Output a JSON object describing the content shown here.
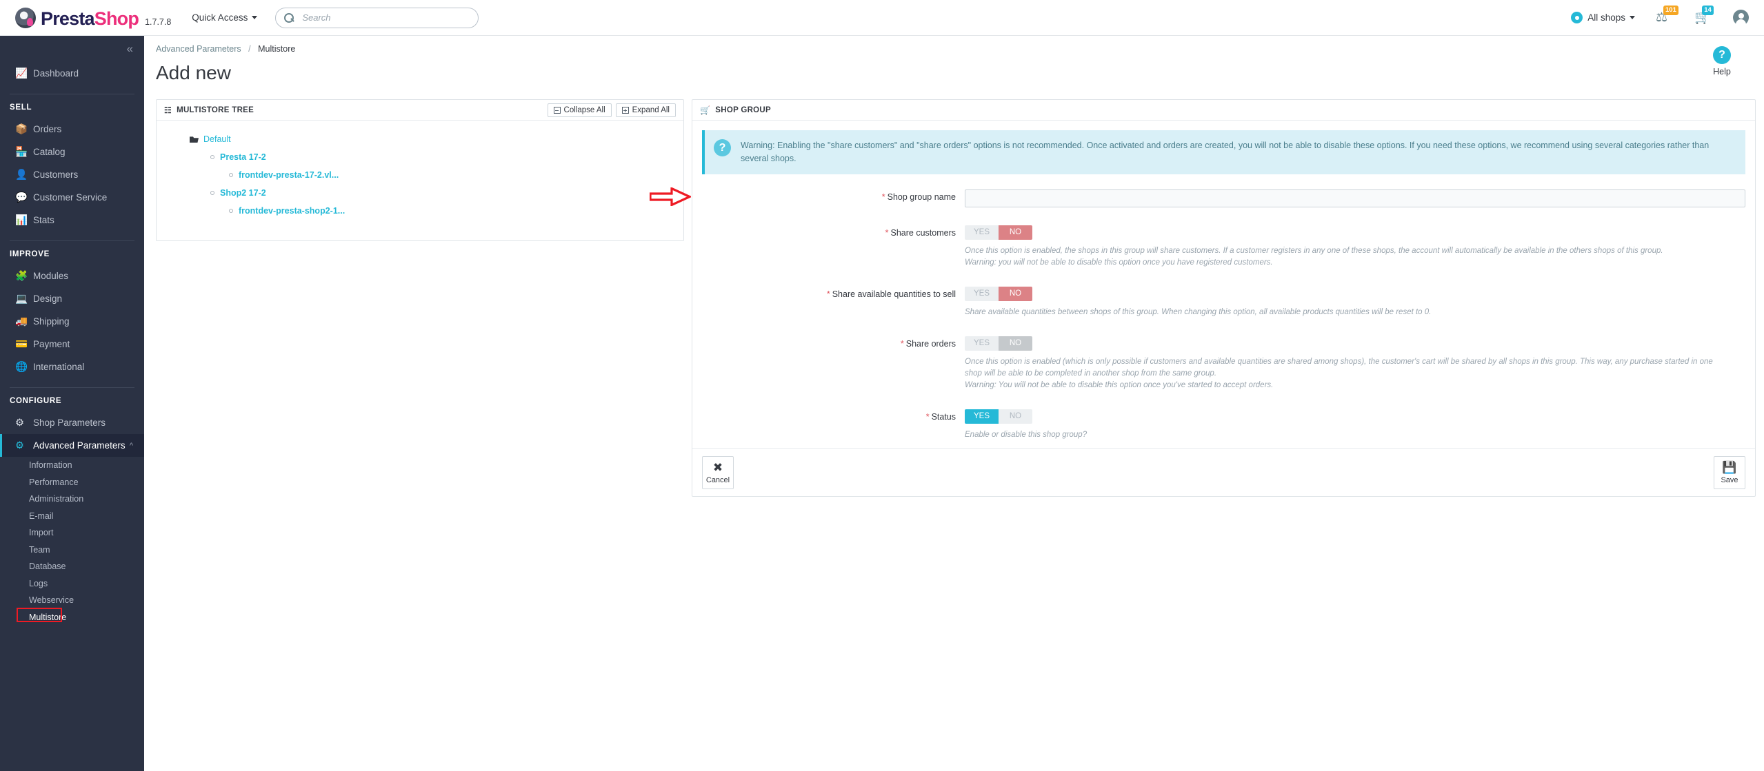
{
  "header": {
    "logo_name_part1": "Presta",
    "logo_name_part2": "Shop",
    "version": "1.7.7.8",
    "quick_access_label": "Quick Access",
    "search_placeholder": "Search",
    "search_value": "",
    "all_shops_label": "All shops",
    "badge_orders_count": "101",
    "badge_cart_count": "14"
  },
  "sidebar": {
    "collapse_label": "«",
    "dashboard_label": "Dashboard",
    "group_sell": "SELL",
    "sell_items": [
      {
        "label": "Orders"
      },
      {
        "label": "Catalog"
      },
      {
        "label": "Customers"
      },
      {
        "label": "Customer Service"
      },
      {
        "label": "Stats"
      }
    ],
    "group_improve": "IMPROVE",
    "improve_items": [
      {
        "label": "Modules"
      },
      {
        "label": "Design"
      },
      {
        "label": "Shipping"
      },
      {
        "label": "Payment"
      },
      {
        "label": "International"
      }
    ],
    "group_configure": "CONFIGURE",
    "configure_items": [
      {
        "label": "Shop Parameters"
      },
      {
        "label": "Advanced Parameters"
      }
    ],
    "advanced_sub_items": [
      {
        "label": "Information"
      },
      {
        "label": "Performance"
      },
      {
        "label": "Administration"
      },
      {
        "label": "E-mail"
      },
      {
        "label": "Import"
      },
      {
        "label": "Team"
      },
      {
        "label": "Database"
      },
      {
        "label": "Logs"
      },
      {
        "label": "Webservice"
      },
      {
        "label": "Multistore"
      }
    ]
  },
  "breadcrumb": {
    "parent": "Advanced Parameters",
    "separator": "/",
    "current": "Multistore"
  },
  "page": {
    "title": "Add new",
    "help_label": "Help"
  },
  "tree_panel": {
    "title": "MULTISTORE TREE",
    "collapse_all_label": "Collapse All",
    "expand_all_label": "Expand All",
    "nodes": {
      "root": "Default",
      "shop_group_1": "Presta 17-2",
      "shop_url_1": "frontdev-presta-17-2.vl...",
      "shop_group_2": "Shop2 17-2",
      "shop_url_2": "frontdev-presta-shop2-1..."
    }
  },
  "form_panel": {
    "title": "SHOP GROUP",
    "warning": "Warning: Enabling the \"share customers\" and \"share orders\" options is not recommended. Once activated and orders are created, you will not be able to disable these options. If you need these options, we recommend using several categories rather than several shops.",
    "fields": {
      "shop_group_name": {
        "label": "Shop group name",
        "value": "",
        "required": true
      },
      "share_customers": {
        "label": "Share customers",
        "yes_label": "YES",
        "no_label": "NO",
        "selected": "NO",
        "hint_line1": "Once this option is enabled, the shops in this group will share customers. If a customer registers in any one of these shops, the account will automatically be available in the others shops of this group.",
        "hint_line2": "Warning: you will not be able to disable this option once you have registered customers."
      },
      "share_quantities": {
        "label": "Share available quantities to sell",
        "yes_label": "YES",
        "no_label": "NO",
        "selected": "NO",
        "hint_line1": "Share available quantities between shops of this group. When changing this option, all available products quantities will be reset to 0."
      },
      "share_orders": {
        "label": "Share orders",
        "yes_label": "YES",
        "no_label": "NO",
        "selected": "NO",
        "disabled": true,
        "hint_line1": "Once this option is enabled (which is only possible if customers and available quantities are shared among shops), the customer's cart will be shared by all shops in this group. This way, any purchase started in one",
        "hint_line2": "shop will be able to be completed in another shop from the same group.",
        "hint_line3": "Warning: You will not be able to disable this option once you've started to accept orders."
      },
      "status": {
        "label": "Status",
        "yes_label": "YES",
        "no_label": "NO",
        "selected": "YES",
        "hint_line1": "Enable or disable this shop group?"
      }
    },
    "footer": {
      "cancel_label": "Cancel",
      "save_label": "Save"
    }
  },
  "colors": {
    "accent_blue": "#25b9d7",
    "toggle_no_red": "#dc8286",
    "toggle_no_gray": "#c5c9cc",
    "required_red": "#e0565f",
    "annotation_red": "#ee1b24",
    "sidebar_bg": "#2b3244"
  }
}
